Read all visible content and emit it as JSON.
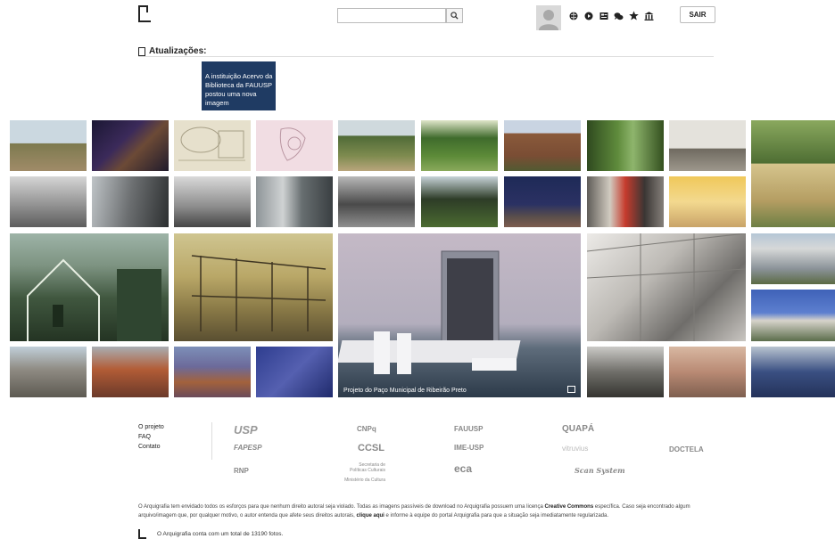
{
  "header": {
    "search_placeholder": "",
    "logout_label": "SAIR",
    "icons": [
      "globe-icon",
      "play-circle-icon",
      "photo-list-icon",
      "chat-icon",
      "star-icon",
      "institution-icon"
    ]
  },
  "updates": {
    "title": "Atualizações:",
    "card_text": "A instituição Acervo da Biblioteca da FAUUSP postou uma nova imagem"
  },
  "gallery": {
    "featured_caption": "Projeto do Paço Municipal de Ribeirão Preto"
  },
  "footer": {
    "links": [
      "O projeto",
      "FAQ",
      "Contato"
    ],
    "partners": [
      "USP",
      "CNPq",
      "FAUUSP",
      "QUAPÁ",
      "FAPESP",
      "CCSL",
      "IME-USP",
      "vitruvius",
      "DOCTELA",
      "RNP",
      "Secretaria de Políticas Culturais",
      "Ministério da Cultura",
      "eca",
      "Scan System"
    ],
    "notice": "O Arquigrafia tem envidado todos os esforços para que nenhum direito autoral seja violado. Todas as imagens passíveis de download no Arquigrafia possuem uma licença",
    "notice_bold1": "Creative Commons",
    "notice_mid": "específica. Caso seja encontrado algum arquivo/imagem que, por qualquer motivo, o autor entenda que afete seus direitos autorais,",
    "notice_bold2": "clique aqui",
    "notice_end": "e informe à equipe do portal Arquigrafia para que a situação seja imediatamente regularizada.",
    "total": "O Arquigrafia conta com um total de 13190 fotos."
  }
}
